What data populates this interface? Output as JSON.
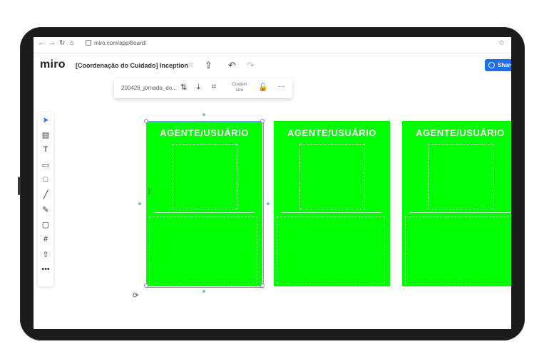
{
  "browser": {
    "url": "miro.com/app/board/",
    "nav_icons": [
      "back-icon",
      "forward-icon",
      "reload-icon",
      "home-icon"
    ]
  },
  "header": {
    "logo": "miro",
    "board_title": "[Coordenação do Cuidado] Inception",
    "share_label": "Share"
  },
  "context_toolbar": {
    "file_name": "200428_jornada_do...",
    "custom_size_line1": "Custom",
    "custom_size_line2": "size"
  },
  "tools": [
    "select-icon",
    "template-icon",
    "text-icon",
    "sticky-note-icon",
    "shape-icon",
    "line-icon",
    "pen-icon",
    "comment-icon",
    "frame-icon",
    "upload-icon",
    "more-icon"
  ],
  "cards": [
    {
      "label": "AGENTE/USUÁRIO"
    },
    {
      "label": "AGENTE/USUÁRIO"
    },
    {
      "label": "AGENTE/USUÁRIO"
    }
  ],
  "colors": {
    "card": "#00ff00",
    "share_button": "#1e6fe8",
    "device_frame": "#1b1b1b"
  }
}
